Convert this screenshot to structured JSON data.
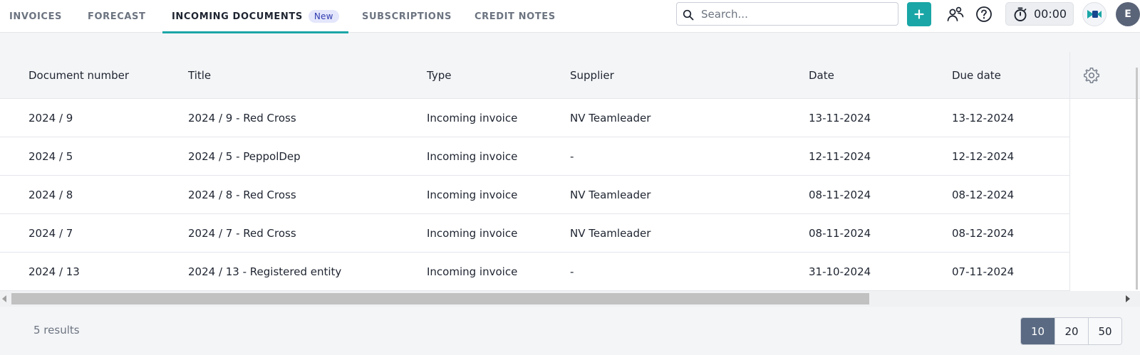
{
  "nav": {
    "tabs": [
      {
        "label": "INVOICES"
      },
      {
        "label": "FORECAST"
      },
      {
        "label": "INCOMING DOCUMENTS",
        "badge": "New",
        "active": true
      },
      {
        "label": "SUBSCRIPTIONS"
      },
      {
        "label": "CREDIT NOTES"
      }
    ]
  },
  "search": {
    "placeholder": "Search..."
  },
  "actions": {
    "add_label": "+",
    "timer_value": "00:00",
    "avatar_initial": "E",
    "accent_color": "#1aa6a6"
  },
  "table": {
    "columns": [
      "Document number",
      "Title",
      "Type",
      "Supplier",
      "Date",
      "Due date"
    ],
    "rows": [
      [
        "2024 / 9",
        "2024 / 9 - Red Cross",
        "Incoming invoice",
        "NV Teamleader",
        "13-11-2024",
        "13-12-2024"
      ],
      [
        "2024 / 5",
        "2024 / 5 - PeppolDep",
        "Incoming invoice",
        "-",
        "12-11-2024",
        "12-12-2024"
      ],
      [
        "2024 / 8",
        "2024 / 8 - Red Cross",
        "Incoming invoice",
        "NV Teamleader",
        "08-11-2024",
        "08-12-2024"
      ],
      [
        "2024 / 7",
        "2024 / 7 - Red Cross",
        "Incoming invoice",
        "NV Teamleader",
        "08-11-2024",
        "08-12-2024"
      ],
      [
        "2024 / 13",
        "2024 / 13 - Registered entity",
        "Incoming invoice",
        "-",
        "31-10-2024",
        "07-11-2024"
      ]
    ]
  },
  "footer": {
    "results_text": "5 results",
    "page_sizes": [
      "10",
      "20",
      "50"
    ],
    "active_page_size": "10"
  }
}
